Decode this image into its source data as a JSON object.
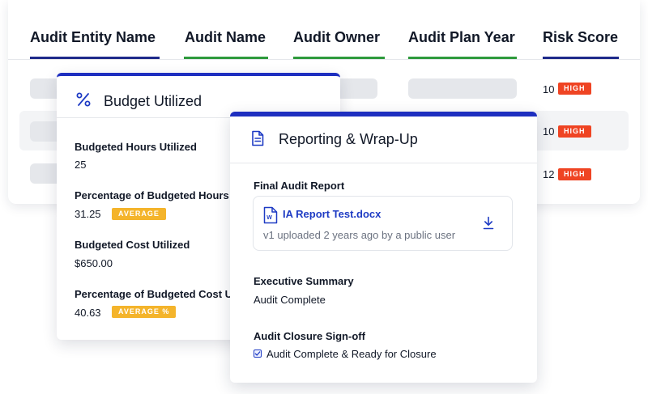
{
  "table": {
    "columns": [
      {
        "label": "Audit Entity Name",
        "accent": "#1e2a8a"
      },
      {
        "label": "Audit Name",
        "accent": "#2e9a3c"
      },
      {
        "label": "Audit Owner",
        "accent": "#2e9a3c"
      },
      {
        "label": "Audit Plan Year",
        "accent": "#2e9a3c"
      },
      {
        "label": "Risk Score",
        "accent": "#1e2a8a"
      }
    ],
    "rows": [
      {
        "risk_score": "10",
        "risk_level": "HIGH"
      },
      {
        "risk_score": "10",
        "risk_level": "HIGH"
      },
      {
        "risk_score": "12",
        "risk_level": "HIGH"
      }
    ]
  },
  "budget": {
    "title": "Budget Utilized",
    "icon": "percent-icon",
    "fields": [
      {
        "label": "Budgeted Hours Utilized",
        "value": "25"
      },
      {
        "label": "Percentage of Budgeted Hours",
        "value": "31.25",
        "badge": "AVERAGE"
      },
      {
        "label": "Budgeted Cost Utilized",
        "value": "$650.00"
      },
      {
        "label": "Percentage of Budgeted Cost U",
        "value": "40.63",
        "badge": "AVERAGE %"
      }
    ]
  },
  "report": {
    "title": "Reporting & Wrap-Up",
    "icon": "document-icon",
    "final_report_label": "Final Audit Report",
    "file_name": "IA Report Test.docx",
    "file_meta": "v1 uploaded 2 years ago by a public user",
    "file_icon_letter": "W",
    "exec_summary_label": "Executive Summary",
    "exec_summary_value": "Audit Complete",
    "closure_label": "Audit Closure Sign-off",
    "closure_checkbox_label": "Audit Complete & Ready for Closure",
    "closure_checked": true
  },
  "colors": {
    "accent_blue": "#1e2fc0",
    "link_blue": "#1e3bc4",
    "high_red": "#ef4423",
    "average_amber": "#f4b42b"
  }
}
